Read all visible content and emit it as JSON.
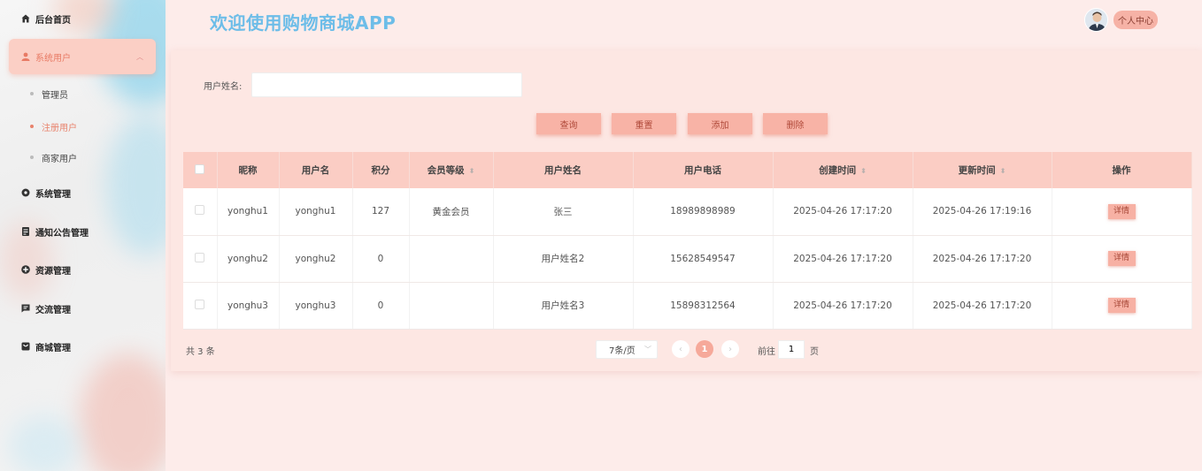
{
  "app": {
    "title": "欢迎使用购物商城APP"
  },
  "header": {
    "profile_label": "个人中心"
  },
  "sidebar": {
    "items": [
      {
        "label": "后台首页",
        "icon": "home-icon"
      },
      {
        "label": "系统用户",
        "icon": "user-icon"
      },
      {
        "label": "系统管理",
        "icon": "gear-icon"
      },
      {
        "label": "通知公告管理",
        "icon": "document-icon"
      },
      {
        "label": "资源管理",
        "icon": "plus-circle-icon"
      },
      {
        "label": "交流管理",
        "icon": "chat-icon"
      },
      {
        "label": "商城管理",
        "icon": "shop-icon"
      }
    ],
    "sub_items": [
      {
        "label": "管理员"
      },
      {
        "label": "注册用户"
      },
      {
        "label": "商家用户"
      }
    ]
  },
  "search": {
    "label": "用户姓名:",
    "value": "",
    "placeholder": ""
  },
  "buttons": {
    "query": "查询",
    "reset": "重置",
    "add": "添加",
    "delete": "删除"
  },
  "table": {
    "headers": [
      "昵称",
      "用户名",
      "积分",
      "会员等级",
      "用户姓名",
      "用户电话",
      "创建时间",
      "更新时间",
      "操作"
    ],
    "rows": [
      {
        "nickname": "yonghu1",
        "username": "yonghu1",
        "points": "127",
        "level": "黄金会员",
        "realname": "张三",
        "phone": "18989898989",
        "created": "2025-04-26 17:17:20",
        "updated": "2025-04-26 17:19:16",
        "action": "详情"
      },
      {
        "nickname": "yonghu2",
        "username": "yonghu2",
        "points": "0",
        "level": "",
        "realname": "用户姓名2",
        "phone": "15628549547",
        "created": "2025-04-26 17:17:20",
        "updated": "2025-04-26 17:17:20",
        "action": "详情"
      },
      {
        "nickname": "yonghu3",
        "username": "yonghu3",
        "points": "0",
        "level": "",
        "realname": "用户姓名3",
        "phone": "15898312564",
        "created": "2025-04-26 17:17:20",
        "updated": "2025-04-26 17:17:20",
        "action": "详情"
      }
    ]
  },
  "pagination": {
    "total": "共 3 条",
    "page_size": "7条/页",
    "current_page": "1",
    "goto_label": "前往",
    "goto_value": "1",
    "goto_suffix": "页"
  },
  "colors": {
    "accent": "#f8b3a6",
    "title": "#6dbde8",
    "background": "#fdecea"
  }
}
